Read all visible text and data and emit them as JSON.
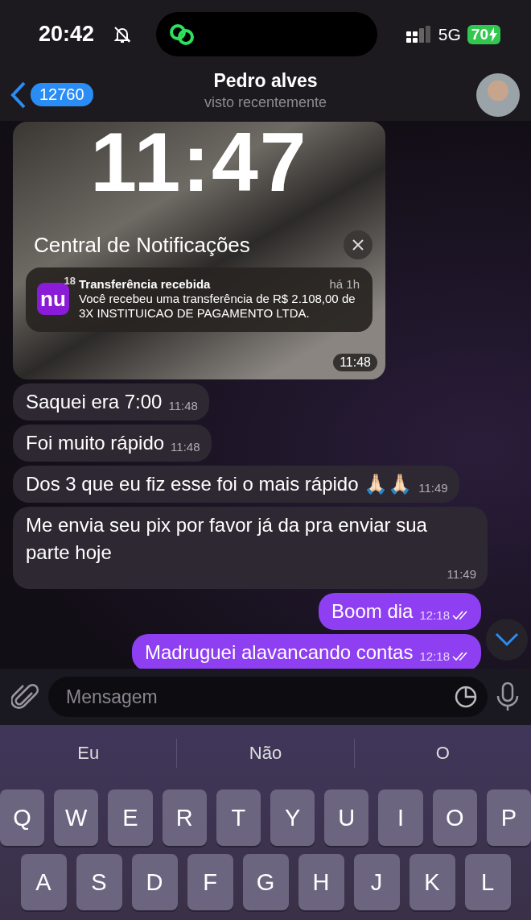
{
  "status_bar": {
    "time": "20:42",
    "network": "5G",
    "battery": "70"
  },
  "header": {
    "back_count": "12760",
    "name": "Pedro alves",
    "status": "visto recentemente"
  },
  "messages": [
    {
      "kind": "image",
      "time": "11:48",
      "screenshot": {
        "clock": "11:47",
        "title": "Central de Notificações",
        "notification": {
          "app_icon": "nu",
          "badge": "18",
          "title": "Transferência recebida",
          "age": "há 1h",
          "body": "Você recebeu uma transferência de R$ 2.108,00 de 3X INSTITUICAO DE PAGAMENTO LTDA."
        }
      }
    },
    {
      "kind": "text",
      "outgoing": false,
      "text": "Saquei era 7:00",
      "time": "11:48"
    },
    {
      "kind": "text",
      "outgoing": false,
      "text": "Foi muito rápido",
      "time": "11:48"
    },
    {
      "kind": "text",
      "outgoing": false,
      "text": "Dos 3 que eu fiz esse foi o mais rápido 🙏🏻🙏🏻",
      "time": "11:49"
    },
    {
      "kind": "text",
      "outgoing": false,
      "text": "Me envia seu pix por favor já da pra enviar sua parte hoje",
      "time": "11:49"
    },
    {
      "kind": "text",
      "outgoing": true,
      "text": "Boom dia",
      "time": "12:18",
      "read": true
    },
    {
      "kind": "text",
      "outgoing": true,
      "text": "Madruguei alavancando contas",
      "time": "12:18",
      "read": true
    }
  ],
  "composer": {
    "placeholder": "Mensagem"
  },
  "keyboard": {
    "suggestions": [
      "Eu",
      "Não",
      "O"
    ],
    "rows": [
      [
        "Q",
        "W",
        "E",
        "R",
        "T",
        "Y",
        "U",
        "I",
        "O",
        "P"
      ],
      [
        "A",
        "S",
        "D",
        "F",
        "G",
        "H",
        "J",
        "K",
        "L"
      ]
    ]
  }
}
